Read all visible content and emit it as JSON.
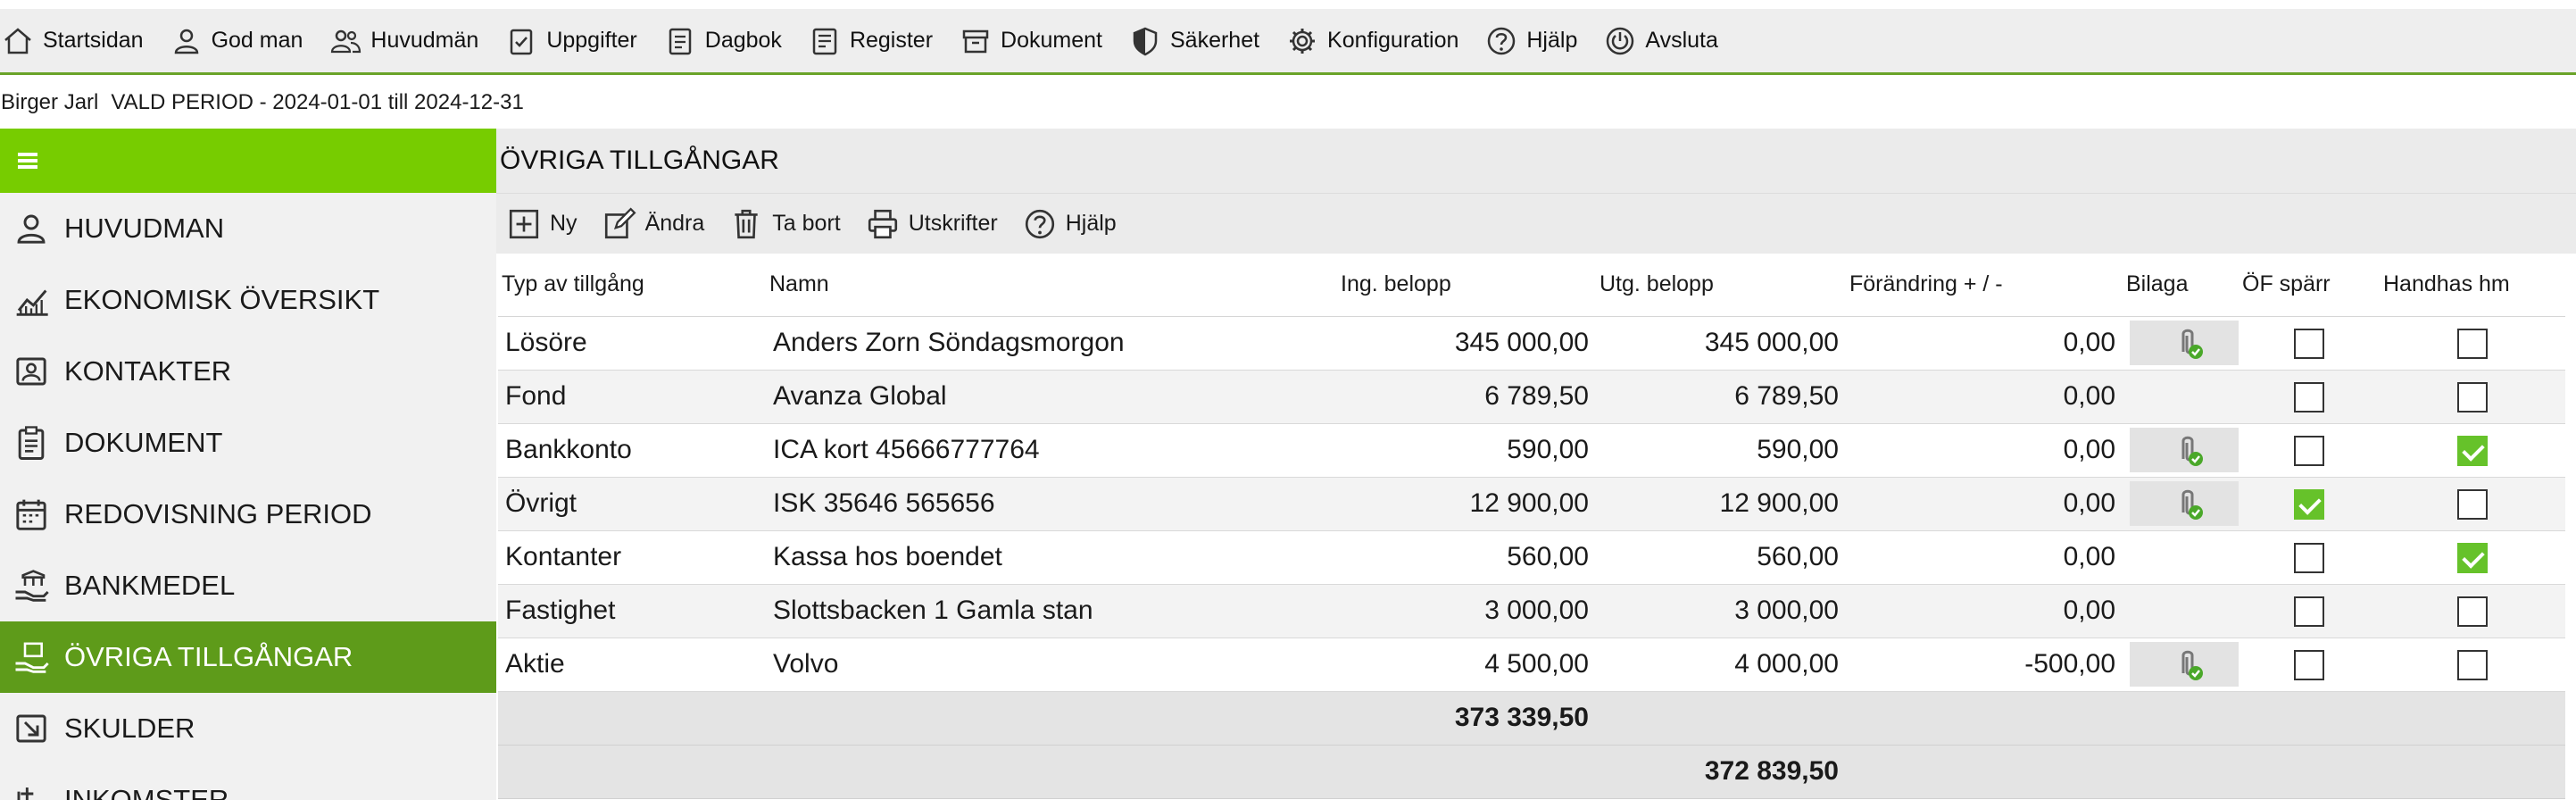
{
  "menu": [
    {
      "label": "Startsidan",
      "icon": "home-icon"
    },
    {
      "label": "God man",
      "icon": "person-icon"
    },
    {
      "label": "Huvudmän",
      "icon": "people-icon"
    },
    {
      "label": "Uppgifter",
      "icon": "task-check-icon"
    },
    {
      "label": "Dagbok",
      "icon": "journal-icon"
    },
    {
      "label": "Register",
      "icon": "register-icon"
    },
    {
      "label": "Dokument",
      "icon": "archive-icon"
    },
    {
      "label": "Säkerhet",
      "icon": "shield-icon"
    },
    {
      "label": "Konfiguration",
      "icon": "gear-icon"
    },
    {
      "label": "Hjälp",
      "icon": "help-icon"
    },
    {
      "label": "Avsluta",
      "icon": "power-icon"
    }
  ],
  "info": {
    "user": "Birger Jarl",
    "period": "VALD PERIOD - 2024-01-01 till 2024-12-31"
  },
  "sidebar": {
    "items": [
      {
        "label": "HUVUDMAN",
        "icon": "person-icon",
        "active": false
      },
      {
        "label": "EKONOMISK ÖVERSIKT",
        "icon": "chart-icon",
        "active": false
      },
      {
        "label": "KONTAKTER",
        "icon": "contact-icon",
        "active": false
      },
      {
        "label": "DOKUMENT",
        "icon": "clipboard-icon",
        "active": false
      },
      {
        "label": "REDOVISNING PERIOD",
        "icon": "calendar-icon",
        "active": false
      },
      {
        "label": "BANKMEDEL",
        "icon": "bank-hand-icon",
        "active": false
      },
      {
        "label": "ÖVRIGA TILLGÅNGAR",
        "icon": "assets-hand-icon",
        "active": true
      },
      {
        "label": "SKULDER",
        "icon": "debt-icon",
        "active": false
      },
      {
        "label": "INKOMSTER",
        "icon": "income-icon",
        "active": false
      }
    ]
  },
  "main": {
    "title": "ÖVRIGA TILLGÅNGAR",
    "toolbar": [
      {
        "label": "Ny",
        "icon": "plus-square-icon"
      },
      {
        "label": "Ändra",
        "icon": "edit-icon"
      },
      {
        "label": "Ta bort",
        "icon": "trash-icon"
      },
      {
        "label": "Utskrifter",
        "icon": "printer-icon"
      },
      {
        "label": "Hjälp",
        "icon": "help-icon"
      }
    ],
    "columns": [
      "Typ av tillgång",
      "Namn",
      "Ing. belopp",
      "Utg. belopp",
      "Förändring + / -",
      "Bilaga",
      "ÖF spärr",
      "Handhas hm"
    ],
    "rows": [
      {
        "typ": "Lösöre",
        "namn": "Anders Zorn Söndagsmorgon",
        "ing": "345 000,00",
        "utg": "345 000,00",
        "forandring": "0,00",
        "bilaga": true,
        "of_sparr": false,
        "handhas": false
      },
      {
        "typ": "Fond",
        "namn": "Avanza Global",
        "ing": "6 789,50",
        "utg": "6 789,50",
        "forandring": "0,00",
        "bilaga": false,
        "of_sparr": false,
        "handhas": false
      },
      {
        "typ": "Bankkonto",
        "namn": "ICA kort 45666777764",
        "ing": "590,00",
        "utg": "590,00",
        "forandring": "0,00",
        "bilaga": true,
        "of_sparr": false,
        "handhas": true
      },
      {
        "typ": "Övrigt",
        "namn": "ISK 35646 565656",
        "ing": "12 900,00",
        "utg": "12 900,00",
        "forandring": "0,00",
        "bilaga": true,
        "of_sparr": true,
        "handhas": false
      },
      {
        "typ": "Kontanter",
        "namn": "Kassa hos boendet",
        "ing": "560,00",
        "utg": "560,00",
        "forandring": "0,00",
        "bilaga": false,
        "of_sparr": false,
        "handhas": true
      },
      {
        "typ": "Fastighet",
        "namn": "Slottsbacken 1 Gamla stan",
        "ing": "3 000,00",
        "utg": "3 000,00",
        "forandring": "0,00",
        "bilaga": false,
        "of_sparr": false,
        "handhas": false
      },
      {
        "typ": "Aktie",
        "namn": "Volvo",
        "ing": "4 500,00",
        "utg": "4 000,00",
        "forandring": "-500,00",
        "bilaga": true,
        "of_sparr": false,
        "handhas": false
      }
    ],
    "totals": {
      "ing": "373 339,50",
      "utg": "372 839,50"
    }
  },
  "colors": {
    "accent_green": "#77cc00",
    "active_green": "#5e9b1a",
    "check_green": "#66c22a"
  }
}
